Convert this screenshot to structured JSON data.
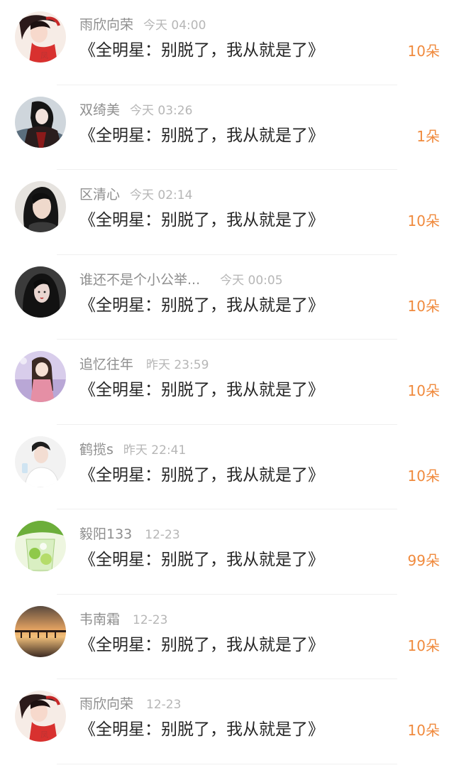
{
  "comments": [
    {
      "name": "雨欣向荣",
      "time": "今天 04:00",
      "message": "《全明星：别脱了，我从就是了》",
      "gift": "10朵",
      "avatar": "anime-girl-red-avatar"
    },
    {
      "name": "双绮美",
      "time": "今天 03:26",
      "message": "《全明星：别脱了，我从就是了》",
      "gift": "1朵",
      "avatar": "dark-robed-figure-avatar"
    },
    {
      "name": "区清心",
      "time": "今天 02:14",
      "message": "《全明星：别脱了，我从就是了》",
      "gift": "10朵",
      "avatar": "girl-portrait-avatar"
    },
    {
      "name": "谁还不是个小公举...",
      "time": "今天 00:05",
      "message": "《全明星：别脱了，我从就是了》",
      "gift": "10朵",
      "avatar": "dark-hair-girl-avatar"
    },
    {
      "name": "追忆往年",
      "time": "昨天 23:59",
      "message": "《全明星：别脱了，我从就是了》",
      "gift": "10朵",
      "avatar": "anime-girl-purple-avatar"
    },
    {
      "name": "鹤揽s",
      "time": "昨天 22:41",
      "message": "《全明星：别脱了，我从就是了》",
      "gift": "10朵",
      "avatar": "young-man-white-shirt-avatar"
    },
    {
      "name": "毅阳133",
      "time": "12-23",
      "message": "《全明星：别脱了，我从就是了》",
      "gift": "99朵",
      "avatar": "lime-drink-avatar"
    },
    {
      "name": "韦南霜",
      "time": "12-23",
      "message": "《全明星：别脱了，我从就是了》",
      "gift": "10朵",
      "avatar": "sunset-pier-avatar"
    },
    {
      "name": "雨欣向荣",
      "time": "12-23",
      "message": "《全明星：别脱了，我从就是了》",
      "gift": "10朵",
      "avatar": "anime-girl-red-avatar"
    }
  ],
  "colors": {
    "gift": "#f08a3d",
    "name": "#8e8e8e",
    "time": "#b6b6b6",
    "message": "#262626"
  }
}
